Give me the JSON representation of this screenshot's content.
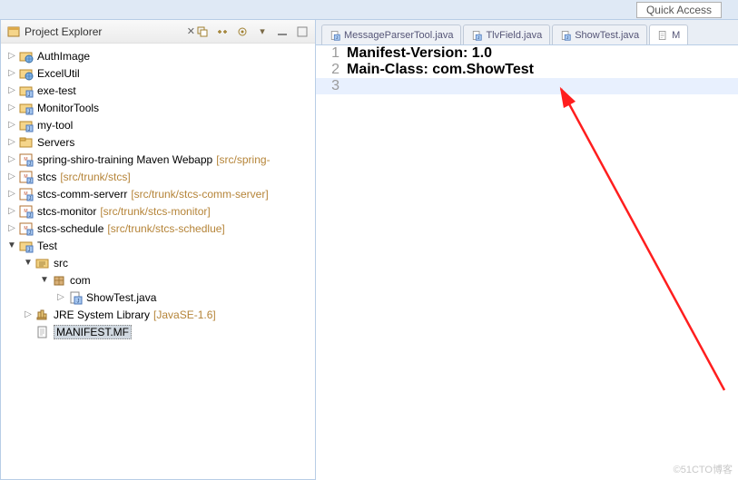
{
  "quick_access": "Quick Access",
  "pane": {
    "title": "Project Explorer",
    "close_glyph": "✕"
  },
  "tree": [
    {
      "indent": 0,
      "arrow": "▷",
      "icon": "web",
      "label": "AuthImage"
    },
    {
      "indent": 0,
      "arrow": "▷",
      "icon": "web",
      "label": "ExcelUtil"
    },
    {
      "indent": 0,
      "arrow": "▷",
      "icon": "java",
      "label": "exe-test"
    },
    {
      "indent": 0,
      "arrow": "▷",
      "icon": "java",
      "label": "MonitorTools"
    },
    {
      "indent": 0,
      "arrow": "▷",
      "icon": "java",
      "label": "my-tool"
    },
    {
      "indent": 0,
      "arrow": "▷",
      "icon": "folder",
      "label": "Servers"
    },
    {
      "indent": 0,
      "arrow": "▷",
      "icon": "mvn",
      "label": "spring-shiro-training Maven Webapp",
      "extra": "[src/spring-"
    },
    {
      "indent": 0,
      "arrow": "▷",
      "icon": "mvn",
      "label": "stcs",
      "extra": "[src/trunk/stcs]"
    },
    {
      "indent": 0,
      "arrow": "▷",
      "icon": "mvn",
      "label": "stcs-comm-serverr",
      "extra": "[src/trunk/stcs-comm-server]"
    },
    {
      "indent": 0,
      "arrow": "▷",
      "icon": "mvn",
      "label": "stcs-monitor",
      "extra": "[src/trunk/stcs-monitor]"
    },
    {
      "indent": 0,
      "arrow": "▷",
      "icon": "mvn",
      "label": "stcs-schedule",
      "extra": "[src/trunk/stcs-schedlue]"
    },
    {
      "indent": 0,
      "arrow": "▼",
      "icon": "java",
      "label": "Test"
    },
    {
      "indent": 1,
      "arrow": "▼",
      "icon": "srcfolder",
      "label": "src"
    },
    {
      "indent": 2,
      "arrow": "▼",
      "icon": "package",
      "label": "com"
    },
    {
      "indent": 3,
      "arrow": "▷",
      "icon": "javafile",
      "label": "ShowTest.java"
    },
    {
      "indent": 1,
      "arrow": "▷",
      "icon": "jre",
      "label": "JRE System Library",
      "extra": "[JavaSE-1.6]"
    },
    {
      "indent": 1,
      "arrow": "",
      "icon": "file",
      "label": "MANIFEST.MF",
      "selected": true
    }
  ],
  "tabs": [
    {
      "icon": "javafile",
      "label": "MessageParserTool.java"
    },
    {
      "icon": "javafile",
      "label": "TlvField.java"
    },
    {
      "icon": "javafile",
      "label": "ShowTest.java"
    },
    {
      "icon": "file",
      "label": "M",
      "active": true,
      "cut": true
    }
  ],
  "code": [
    {
      "n": "1",
      "text": "Manifest-Version: 1.0"
    },
    {
      "n": "2",
      "text": "Main-Class: com.ShowTest"
    },
    {
      "n": "3",
      "text": "",
      "current": true
    }
  ],
  "watermark": "©51CTO博客"
}
